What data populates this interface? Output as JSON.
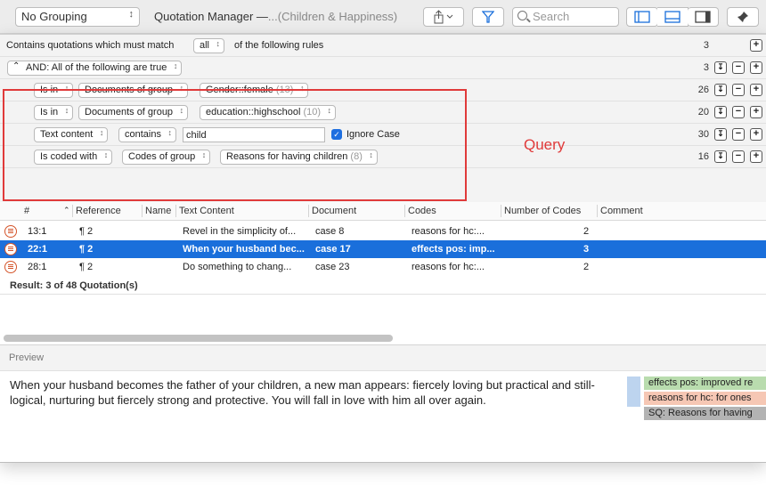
{
  "toolbar": {
    "grouping": "No Grouping",
    "title": "Quotation Manager —",
    "subtitle": "...(Children & Happiness)",
    "search_placeholder": "Search"
  },
  "rules": {
    "header_prefix": "Contains quotations which must match",
    "match_mode": "all",
    "header_suffix": "of the following rules",
    "header_count": "3",
    "and_label": "AND: All of the following are true",
    "and_count": "3",
    "rows": [
      {
        "op": "Is in",
        "scope": "Documents of group",
        "value": "Gender::female",
        "value_count": "(13)",
        "count": "26"
      },
      {
        "op": "Is in",
        "scope": "Documents of group",
        "value": "education::highschool",
        "value_count": "(10)",
        "count": "20"
      },
      {
        "field": "Text content",
        "op": "contains",
        "text": "child",
        "ignore_case": "Ignore Case",
        "count": "30"
      },
      {
        "op": "Is coded with",
        "scope": "Codes of group",
        "value": "Reasons for having children",
        "value_count": "(8)",
        "count": "16"
      }
    ],
    "annotation": "Query"
  },
  "table": {
    "columns": [
      "#",
      "Reference",
      "Name",
      "Text Content",
      "Document",
      "Codes",
      "Number of Codes",
      "Comment"
    ],
    "rows": [
      {
        "id": "13:1",
        "ref": "¶ 2",
        "name": "",
        "text": "Revel in the simplicity of...",
        "doc": "case 8",
        "codes": "reasons for hc:...",
        "ncodes": "2"
      },
      {
        "id": "22:1",
        "ref": "¶ 2",
        "name": "",
        "text": "When your husband bec...",
        "doc": "case 17",
        "codes": "effects pos: imp...",
        "ncodes": "3"
      },
      {
        "id": "28:1",
        "ref": "¶ 2",
        "name": "",
        "text": "Do something to chang...",
        "doc": "case 23",
        "codes": "reasons for hc:...",
        "ncodes": "2"
      }
    ],
    "result": "Result: 3 of 48 Quotation(s)"
  },
  "preview": {
    "label": "Preview",
    "text": "When your husband becomes the father of your children, a new man appears: fiercely loving but practical and still-logical, nurturing but fiercely strong and protective. You will fall in love with him all over again.",
    "codes": [
      {
        "label": "effects pos: improved re",
        "color": "#b9dcae"
      },
      {
        "label": "reasons for hc: for ones",
        "color": "#f6c7b4"
      },
      {
        "label": "SQ: Reasons for having",
        "color": "#b3b3b3"
      }
    ]
  },
  "colors": {
    "accent": "#1a6fdb",
    "query_highlight": "#e03a3a"
  }
}
